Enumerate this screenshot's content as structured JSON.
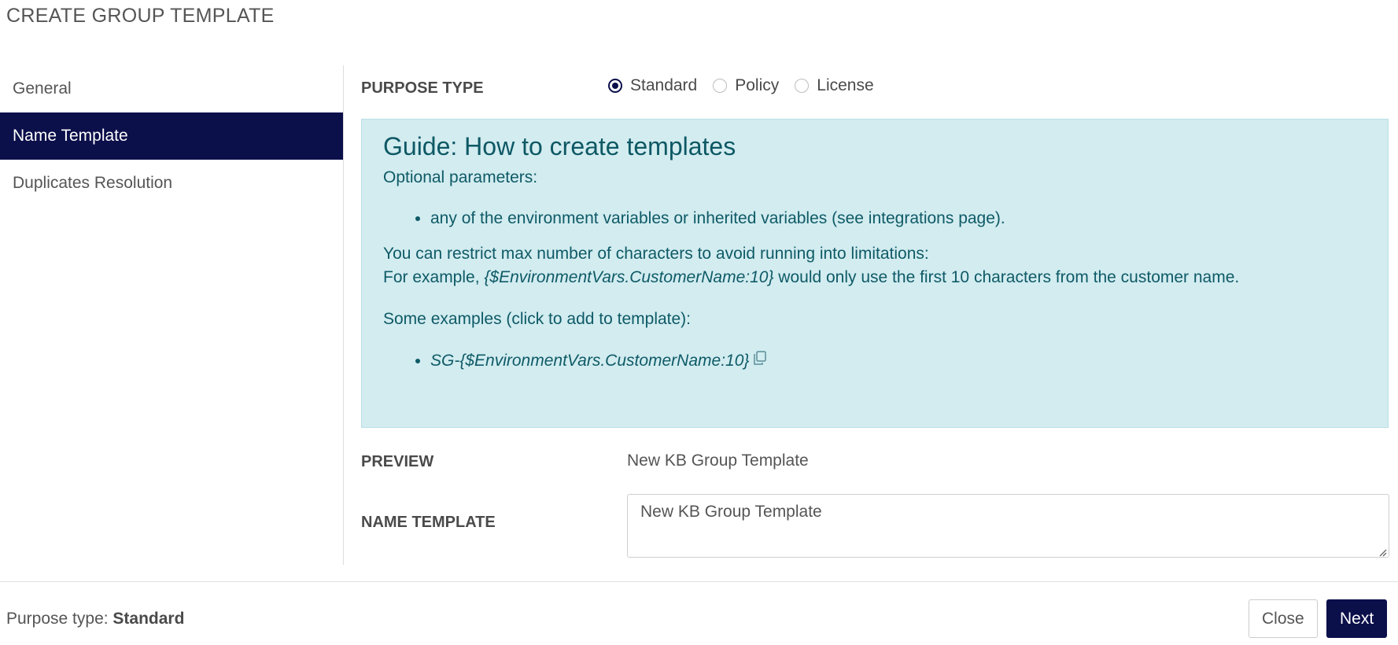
{
  "dialog": {
    "title": "CREATE GROUP TEMPLATE"
  },
  "sidebar": {
    "items": [
      {
        "label": "General",
        "active": false
      },
      {
        "label": "Name Template",
        "active": true
      },
      {
        "label": "Duplicates Resolution",
        "active": false
      }
    ]
  },
  "purpose": {
    "label": "PURPOSE TYPE",
    "options": [
      {
        "label": "Standard",
        "checked": true
      },
      {
        "label": "Policy",
        "checked": false
      },
      {
        "label": "License",
        "checked": false
      }
    ]
  },
  "guide": {
    "title": "Guide: How to create templates",
    "optional_label": "Optional parameters:",
    "optional_items": [
      "any of the environment variables or inherited variables (see integrations page)."
    ],
    "restrict_text": "You can restrict max number of characters to avoid running into limitations:",
    "example_prefix": "For example, ",
    "example_code": "{$EnvironmentVars.CustomerName:10}",
    "example_suffix": " would only use the first 10 characters from the customer name.",
    "examples_label": "Some examples (click to add to template):",
    "examples": [
      "SG-{$EnvironmentVars.CustomerName:10}"
    ]
  },
  "preview": {
    "label": "PREVIEW",
    "value": "New KB Group Template"
  },
  "name_template": {
    "label": "NAME TEMPLATE",
    "value": "New KB Group Template"
  },
  "footer": {
    "status_prefix": "Purpose type: ",
    "status_value": "Standard",
    "close_label": "Close",
    "next_label": "Next"
  },
  "colors": {
    "accent": "#0b0f4a",
    "guide_bg": "#d2ecf0",
    "guide_text": "#0e5a66"
  },
  "icons": {
    "copy": "copy-icon",
    "resize": "resize-grip-icon"
  }
}
